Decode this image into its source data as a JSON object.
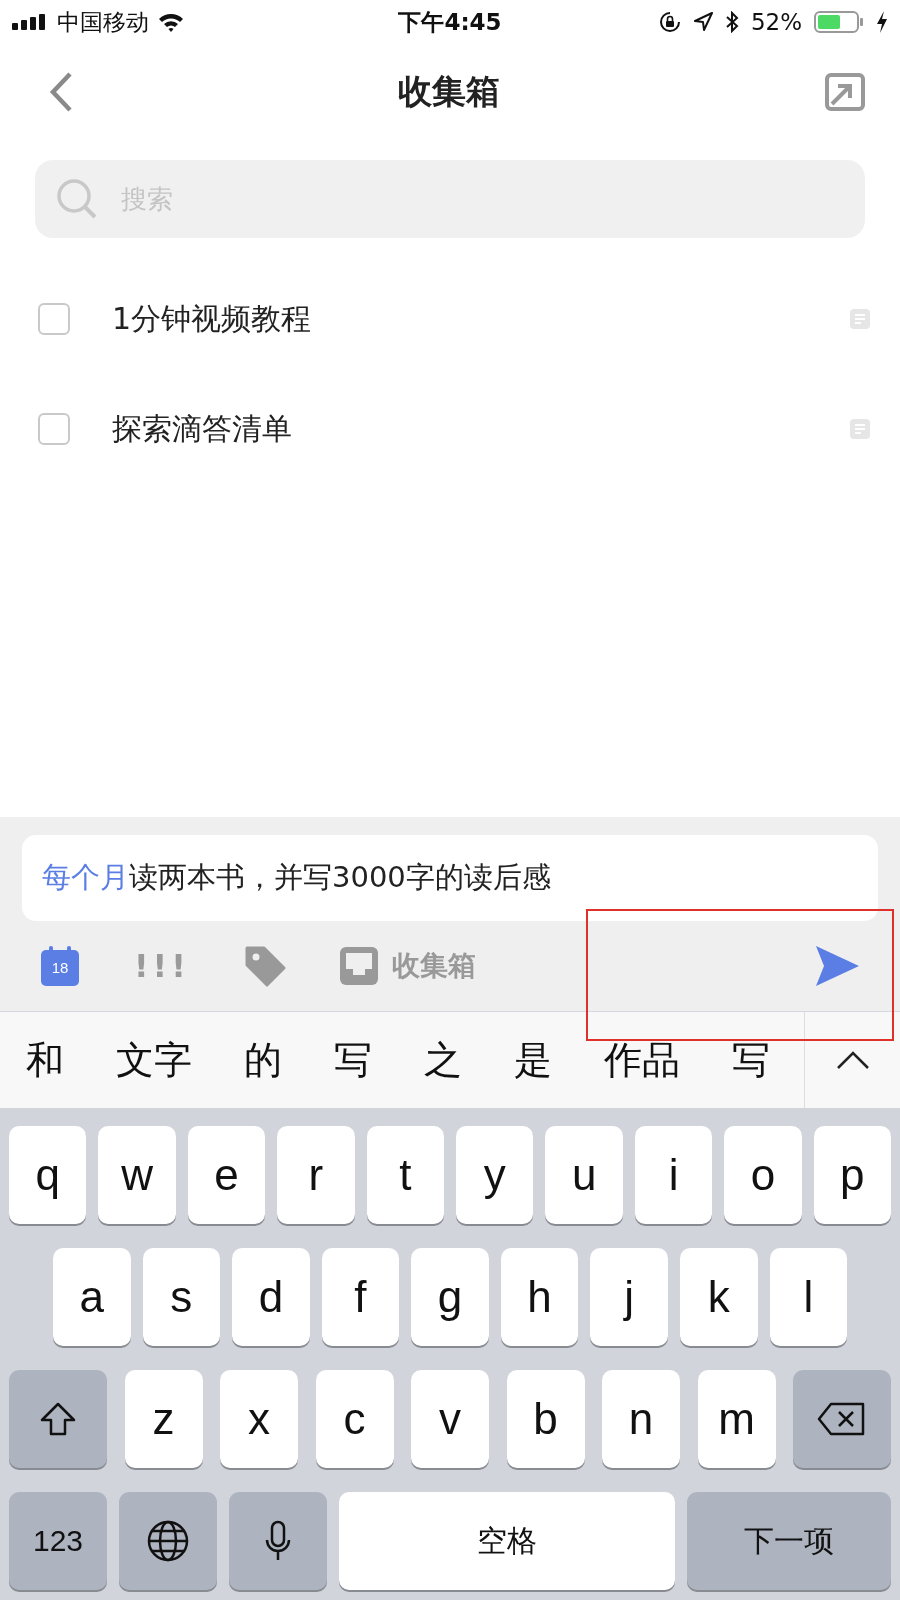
{
  "status_bar": {
    "carrier": "中国移动",
    "time": "下午4:45",
    "battery": "52%"
  },
  "nav": {
    "title": "收集箱"
  },
  "search": {
    "placeholder": "搜索"
  },
  "tasks": [
    {
      "title": "1分钟视频教程",
      "checked": false
    },
    {
      "title": "探索滴答清单",
      "checked": false
    }
  ],
  "composer": {
    "date_token": "每个月",
    "text": "读两本书，并写3000字的读后感",
    "date_badge": "18",
    "priority": "!!!",
    "list_name": "收集箱"
  },
  "candidates": [
    "和",
    "文字",
    "的",
    "写",
    "之",
    "是",
    "作品",
    "写"
  ],
  "keyboard": {
    "row_1": [
      {
        "kind": "letter",
        "label": "q"
      },
      {
        "kind": "letter",
        "label": "w"
      },
      {
        "kind": "letter",
        "label": "e"
      },
      {
        "kind": "letter",
        "label": "r"
      },
      {
        "kind": "letter",
        "label": "t"
      },
      {
        "kind": "letter",
        "label": "y"
      },
      {
        "kind": "letter",
        "label": "u"
      },
      {
        "kind": "letter",
        "label": "i"
      },
      {
        "kind": "letter",
        "label": "o"
      },
      {
        "kind": "letter",
        "label": "p"
      }
    ],
    "row_2": [
      {
        "kind": "letter",
        "label": "a"
      },
      {
        "kind": "letter",
        "label": "s"
      },
      {
        "kind": "letter",
        "label": "d"
      },
      {
        "kind": "letter",
        "label": "f"
      },
      {
        "kind": "letter",
        "label": "g"
      },
      {
        "kind": "letter",
        "label": "h"
      },
      {
        "kind": "letter",
        "label": "j"
      },
      {
        "kind": "letter",
        "label": "k"
      },
      {
        "kind": "letter",
        "label": "l"
      }
    ],
    "row_3": [
      {
        "kind": "shift"
      },
      {
        "kind": "letter",
        "label": "z"
      },
      {
        "kind": "letter",
        "label": "x"
      },
      {
        "kind": "letter",
        "label": "c"
      },
      {
        "kind": "letter",
        "label": "v"
      },
      {
        "kind": "letter",
        "label": "b"
      },
      {
        "kind": "letter",
        "label": "n"
      },
      {
        "kind": "letter",
        "label": "m"
      },
      {
        "kind": "delete"
      }
    ],
    "row_4": [
      {
        "kind": "numbers",
        "label": "123"
      },
      {
        "kind": "globe"
      },
      {
        "kind": "mic"
      },
      {
        "kind": "space",
        "label": "空格"
      },
      {
        "kind": "next",
        "label": "下一项"
      }
    ]
  }
}
